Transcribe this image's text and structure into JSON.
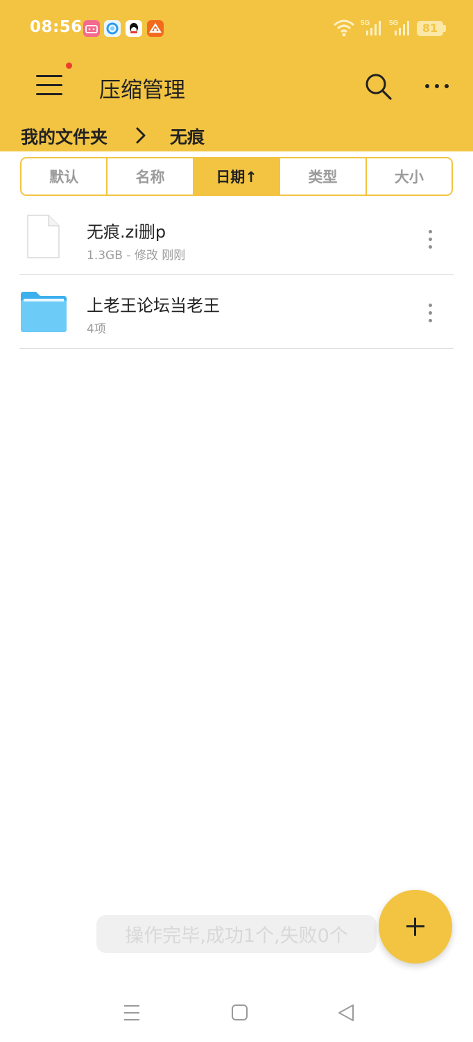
{
  "status_bar": {
    "time": "08:56",
    "app_icons": [
      "bilibili-icon",
      "browser-icon",
      "qq-icon",
      "app-icon"
    ],
    "signal_labels": [
      "5G",
      "5G"
    ],
    "battery": "81"
  },
  "header": {
    "title": "压缩管理",
    "accent_color": "#F2C442"
  },
  "breadcrumb": {
    "root": "我的文件夹",
    "current": "无痕"
  },
  "sort_tabs": [
    {
      "label": "默认",
      "active": false
    },
    {
      "label": "名称",
      "active": false
    },
    {
      "label": "日期↑",
      "active": true
    },
    {
      "label": "类型",
      "active": false
    },
    {
      "label": "大小",
      "active": false
    }
  ],
  "files": [
    {
      "name": "无痕.zi删p",
      "meta": "1.3GB - 修改 刚刚",
      "icon": "document-icon"
    },
    {
      "name": "上老王论坛当老王",
      "meta": "4项",
      "icon": "folder-icon"
    }
  ],
  "toast": "操作完毕,成功1个,失败0个",
  "fab_icon": "plus-icon"
}
